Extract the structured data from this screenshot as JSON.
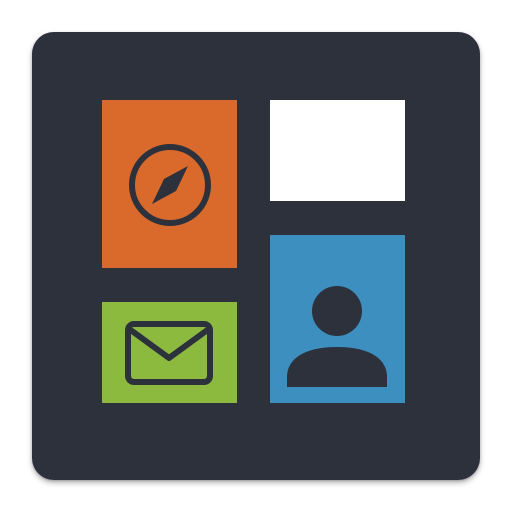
{
  "app_icon": {
    "icon_name": "launcher-tiles-icon",
    "colors": {
      "background": "#2c313c",
      "browser_tile": "#d96a2c",
      "blank_tile": "#ffffff",
      "contact_tile": "#3d8fbf",
      "mail_tile": "#8cba3f",
      "glyph_dark": "#2c313c"
    },
    "tiles": [
      {
        "id": "browser",
        "icon": "compass-icon"
      },
      {
        "id": "blank",
        "icon": "none"
      },
      {
        "id": "contact",
        "icon": "person-icon"
      },
      {
        "id": "mail",
        "icon": "envelope-icon"
      }
    ]
  }
}
